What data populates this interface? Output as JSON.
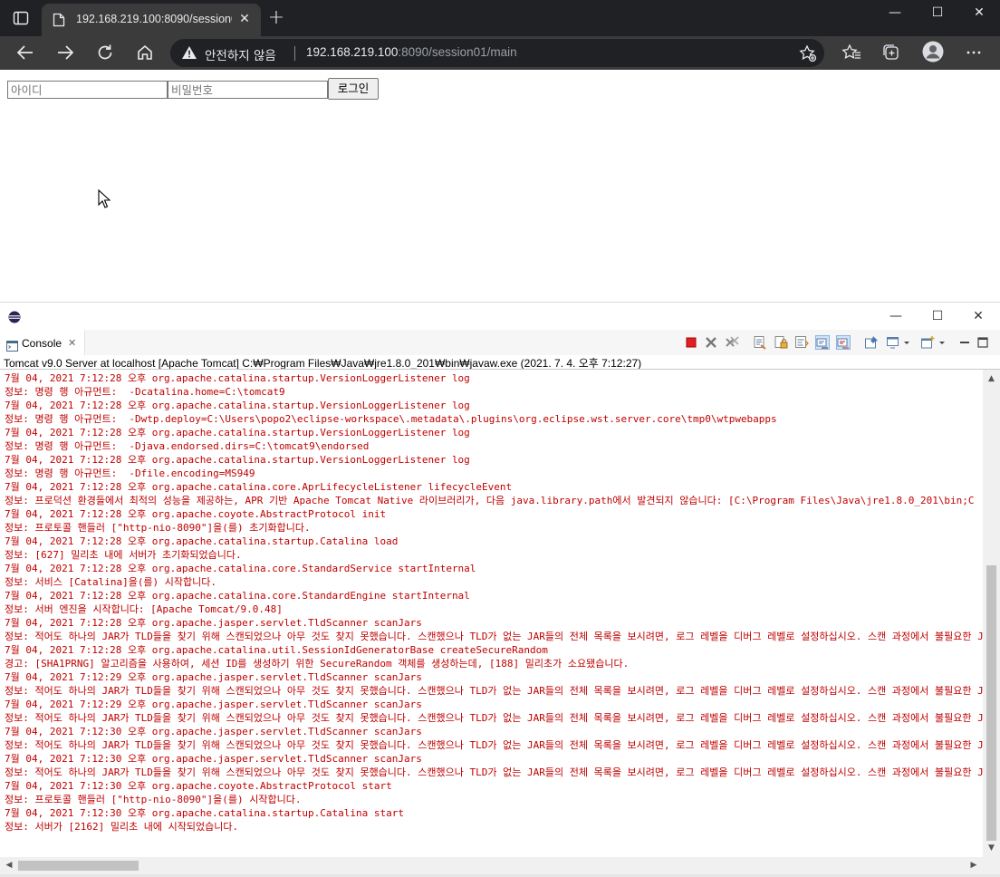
{
  "browser": {
    "tab": {
      "title": "192.168.219.100:8090/session01/main"
    },
    "omnibox": {
      "security_label": "안전하지 않음",
      "url_host": "192.168.219.100",
      "url_rest": ":8090/session01/main"
    },
    "window_controls": {
      "minimize": "—",
      "maximize": "☐",
      "close": "✕"
    }
  },
  "page": {
    "id_placeholder": "아이디",
    "pw_placeholder": "비밀번호",
    "login_button": "로그인"
  },
  "eclipse": {
    "tab_label": "Console",
    "tab_close": "✕",
    "process_line": "Tomcat v9.0 Server at localhost [Apache Tomcat] C:₩Program Files₩Java₩jre1.8.0_201₩bin₩javaw.exe (2021. 7. 4. 오후 7:12:27)",
    "window_controls": {
      "minimize": "—",
      "maximize": "☐",
      "close": "✕"
    },
    "console_lines": [
      "7월 04, 2021 7:12:28 오후 org.apache.catalina.startup.VersionLoggerListener log",
      "정보: 명령 행 아규먼트:  -Dcatalina.home=C:\\tomcat9",
      "7월 04, 2021 7:12:28 오후 org.apache.catalina.startup.VersionLoggerListener log",
      "정보: 명령 행 아규먼트:  -Dwtp.deploy=C:\\Users\\popo2\\eclipse-workspace\\.metadata\\.plugins\\org.eclipse.wst.server.core\\tmp0\\wtpwebapps",
      "7월 04, 2021 7:12:28 오후 org.apache.catalina.startup.VersionLoggerListener log",
      "정보: 명령 행 아규먼트:  -Djava.endorsed.dirs=C:\\tomcat9\\endorsed",
      "7월 04, 2021 7:12:28 오후 org.apache.catalina.startup.VersionLoggerListener log",
      "정보: 명령 행 아규먼트:  -Dfile.encoding=MS949",
      "7월 04, 2021 7:12:28 오후 org.apache.catalina.core.AprLifecycleListener lifecycleEvent",
      "정보: 프로덕션 환경들에서 최적의 성능을 제공하는, APR 기반 Apache Tomcat Native 라이브러리가, 다음 java.library.path에서 발견되지 않습니다: [C:\\Program Files\\Java\\jre1.8.0_201\\bin;C",
      "7월 04, 2021 7:12:28 오후 org.apache.coyote.AbstractProtocol init",
      "정보: 프로토콜 핸들러 [\"http-nio-8090\"]을(를) 초기화합니다.",
      "7월 04, 2021 7:12:28 오후 org.apache.catalina.startup.Catalina load",
      "정보: [627] 밀리초 내에 서버가 초기화되었습니다.",
      "7월 04, 2021 7:12:28 오후 org.apache.catalina.core.StandardService startInternal",
      "정보: 서비스 [Catalina]을(를) 시작합니다.",
      "7월 04, 2021 7:12:28 오후 org.apache.catalina.core.StandardEngine startInternal",
      "정보: 서버 엔진을 시작합니다: [Apache Tomcat/9.0.48]",
      "7월 04, 2021 7:12:28 오후 org.apache.jasper.servlet.TldScanner scanJars",
      "정보: 적어도 하나의 JAR가 TLD들을 찾기 위해 스캔되었으나 아무 것도 찾지 못했습니다. 스캔했으나 TLD가 없는 JAR들의 전체 목록을 보시려면, 로그 레벨을 디버그 레벨로 설정하십시오. 스캔 과정에서 불필요한 JAR들을 건너",
      "7월 04, 2021 7:12:28 오후 org.apache.catalina.util.SessionIdGeneratorBase createSecureRandom",
      "경고: [SHA1PRNG] 알고리즘을 사용하여, 세션 ID를 생성하기 위한 SecureRandom 객체를 생성하는데, [188] 밀리초가 소요됐습니다.",
      "7월 04, 2021 7:12:29 오후 org.apache.jasper.servlet.TldScanner scanJars",
      "정보: 적어도 하나의 JAR가 TLD들을 찾기 위해 스캔되었으나 아무 것도 찾지 못했습니다. 스캔했으나 TLD가 없는 JAR들의 전체 목록을 보시려면, 로그 레벨을 디버그 레벨로 설정하십시오. 스캔 과정에서 불필요한 JAR들을 건너",
      "7월 04, 2021 7:12:29 오후 org.apache.jasper.servlet.TldScanner scanJars",
      "정보: 적어도 하나의 JAR가 TLD들을 찾기 위해 스캔되었으나 아무 것도 찾지 못했습니다. 스캔했으나 TLD가 없는 JAR들의 전체 목록을 보시려면, 로그 레벨을 디버그 레벨로 설정하십시오. 스캔 과정에서 불필요한 JAR들을 건너",
      "7월 04, 2021 7:12:30 오후 org.apache.jasper.servlet.TldScanner scanJars",
      "정보: 적어도 하나의 JAR가 TLD들을 찾기 위해 스캔되었으나 아무 것도 찾지 못했습니다. 스캔했으나 TLD가 없는 JAR들의 전체 목록을 보시려면, 로그 레벨을 디버그 레벨로 설정하십시오. 스캔 과정에서 불필요한 JAR들을 건너",
      "7월 04, 2021 7:12:30 오후 org.apache.jasper.servlet.TldScanner scanJars",
      "정보: 적어도 하나의 JAR가 TLD들을 찾기 위해 스캔되었으나 아무 것도 찾지 못했습니다. 스캔했으나 TLD가 없는 JAR들의 전체 목록을 보시려면, 로그 레벨을 디버그 레벨로 설정하십시오. 스캔 과정에서 불필요한 JAR들을 건너",
      "7월 04, 2021 7:12:30 오후 org.apache.coyote.AbstractProtocol start",
      "정보: 프로토콜 핸들러 [\"http-nio-8090\"]을(를) 시작합니다.",
      "7월 04, 2021 7:12:30 오후 org.apache.catalina.startup.Catalina start",
      "정보: 서버가 [2162] 밀리초 내에 시작되었습니다."
    ]
  },
  "colors": {
    "console_text": "#c00000",
    "browser_dark": "#202124",
    "browser_toolbar": "#3b3b3b"
  }
}
